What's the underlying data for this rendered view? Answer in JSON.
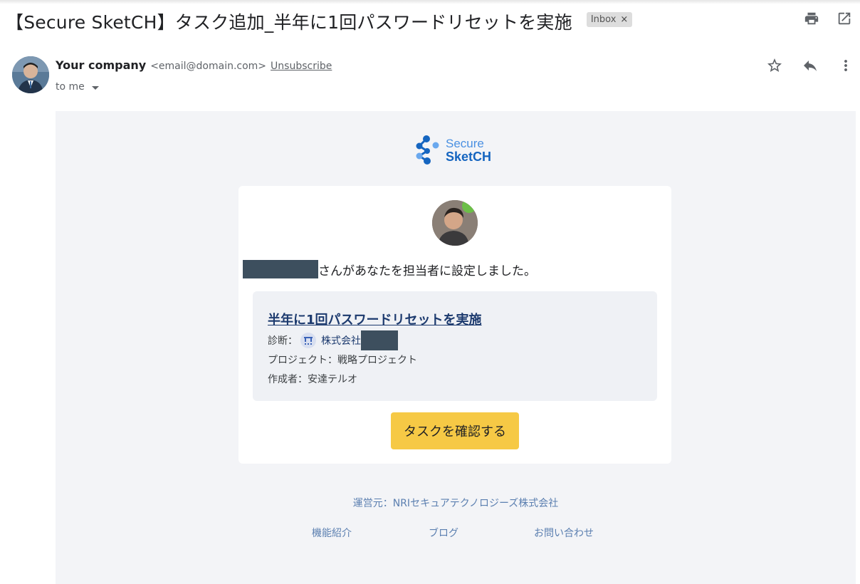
{
  "subject": "【Secure SketCH】タスク追加_半年に1回パスワードリセットを実施",
  "label": {
    "text": "Inbox",
    "remove": "×"
  },
  "sender": {
    "name": "Your company",
    "email": "<email@domain.com>",
    "unsubscribe": "Unsubscribe",
    "to": "to me"
  },
  "logo": {
    "line1": "Secure",
    "line2": "SketCH"
  },
  "card": {
    "assign_message": "さんがあなたを担当者に設定しました。",
    "task": {
      "title": "半年に1回パスワードリセットを実施",
      "diagnosis_label": "診断：",
      "org_name": "株式会社",
      "project": "プロジェクト：戦略プロジェクト",
      "creator": "作成者：安達テルオ"
    },
    "cta": "タスクを確認する"
  },
  "footer": {
    "operator": "運営元：NRIセキュアテクノロジーズ株式会社",
    "links": [
      "機能紹介",
      "ブログ",
      "お問い合わせ"
    ]
  },
  "colors": {
    "brand_dark": "#1565c0",
    "brand_light": "#4a90e2",
    "cta_bg": "#f6c945",
    "link": "#1c3a6e",
    "footer_link": "#5b7fb0",
    "body_bg": "#f3f4f7"
  },
  "icons": [
    "print-icon",
    "open-in-new-icon",
    "star-icon",
    "reply-icon",
    "more-vert-icon",
    "caret-down-icon",
    "brand-logo-icon",
    "organization-icon"
  ]
}
